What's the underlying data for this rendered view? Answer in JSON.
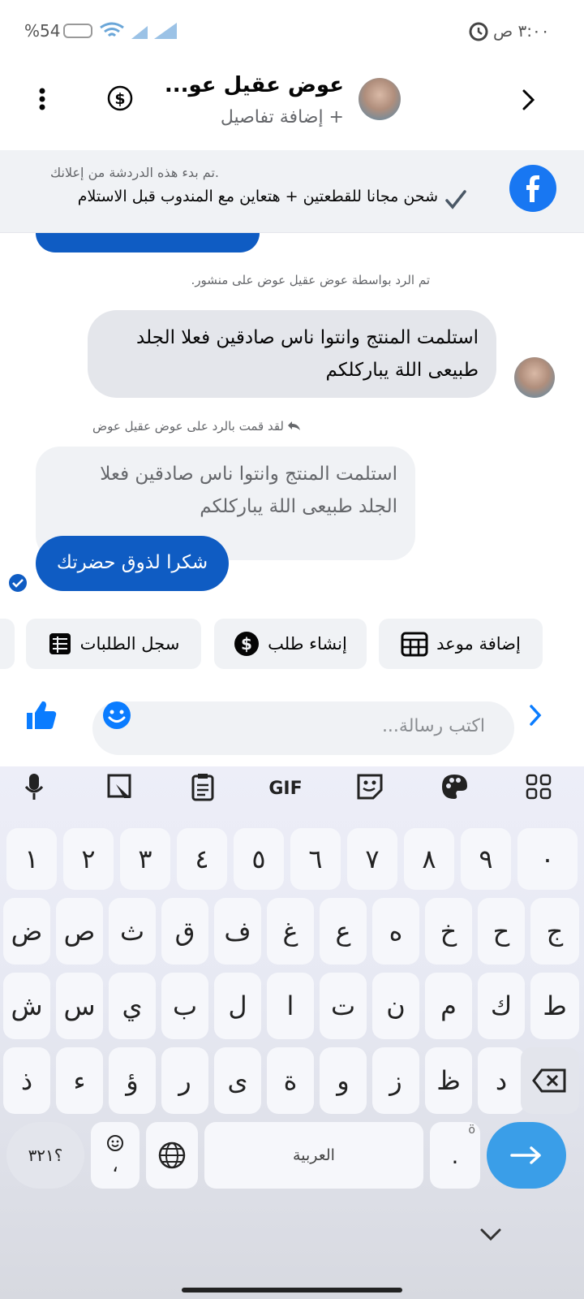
{
  "status_bar": {
    "battery": "%54",
    "time": "٣:٠٠ ص"
  },
  "header": {
    "contact_name": "عوض عقيل عو...",
    "add_details": "+ إضافة تفاصيل"
  },
  "ad_banner": {
    "note": ".تم بدء هذه الدردشة من إعلانك",
    "offer": "شحن مجانا للقطعتين + هتعاين مع المندوب  قبل الاستلام"
  },
  "chat": {
    "reply_note": "تم الرد بواسطة عوض عقيل عوض على منشور.",
    "incoming_line1": "استلمت المنتج وانتوا ناس صادقين فعلا الجلد",
    "incoming_line2": "طبيعى اللة يباركلكم",
    "you_replied": "لقد قمت بالرد على عوض عقيل عوض",
    "quote_line1": "استلمت المنتج وانتوا ناس صادقين فعلا",
    "quote_line2": "الجلد طبيعى اللة يباركلكم",
    "outgoing": "شكرا لذوق حضرتك"
  },
  "quick_actions": [
    {
      "label": "إضافة موعد",
      "icon": "calendar-icon"
    },
    {
      "label": "إنشاء طلب",
      "icon": "dollar-icon"
    },
    {
      "label": "سجل الطلبات",
      "icon": "list-icon"
    }
  ],
  "composer": {
    "placeholder": "اكتب رسالة..."
  },
  "keyboard": {
    "toolbar": {
      "gif": "GIF"
    },
    "row_numbers": [
      "١",
      "٢",
      "٣",
      "٤",
      "٥",
      "٦",
      "٧",
      "٨",
      "٩",
      "٠"
    ],
    "row1": [
      "ض",
      "ص",
      "ث",
      "ق",
      "ف",
      "غ",
      "ع",
      "ه",
      "خ",
      "ح",
      "ج"
    ],
    "row2": [
      "ش",
      "س",
      "ي",
      "ب",
      "ل",
      "ا",
      "ت",
      "ن",
      "م",
      "ك",
      "ط"
    ],
    "row3": [
      "ذ",
      "ء",
      "ؤ",
      "ر",
      "ى",
      "ة",
      "و",
      "ز",
      "ظ",
      "د"
    ],
    "symbols_key": "؟٣٢١",
    "emoji_comma": "،",
    "space_label": "العربية",
    "period": ".",
    "period_hint": "ö"
  },
  "colors": {
    "brand_blue": "#0f5cc3",
    "facebook_blue": "#1877f2",
    "enter_key": "#3a9ee8"
  }
}
